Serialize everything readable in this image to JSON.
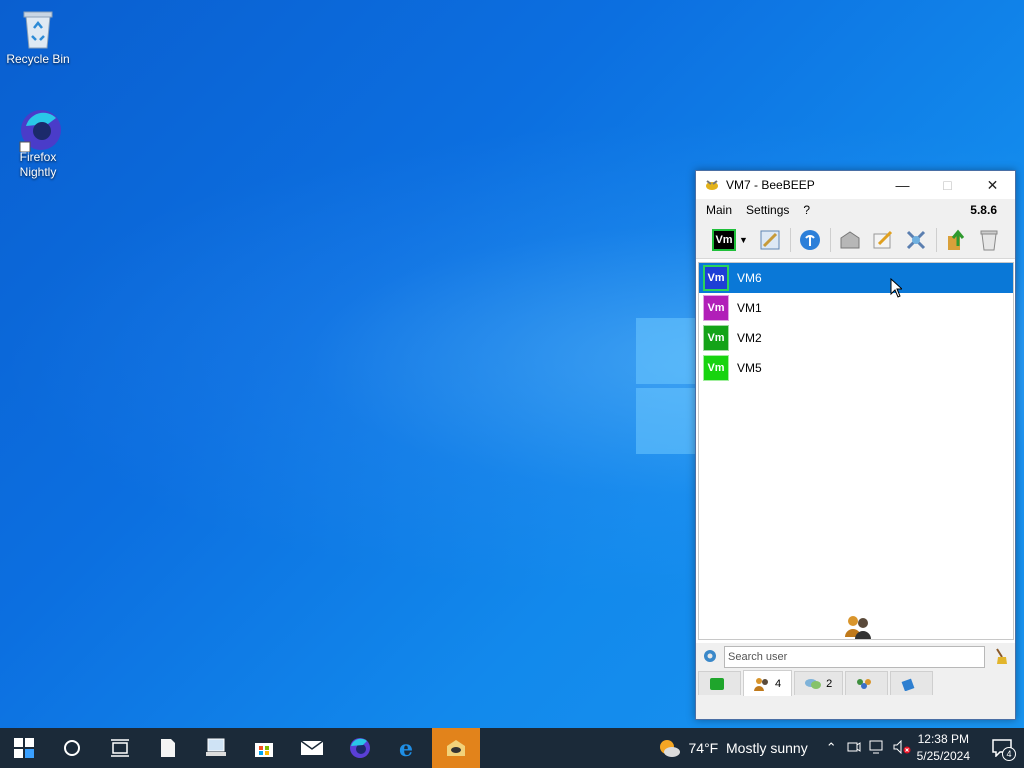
{
  "desktop": {
    "icons": [
      {
        "label": "Recycle Bin"
      },
      {
        "label": "Firefox Nightly"
      }
    ]
  },
  "window": {
    "title": "VM7 - BeeBEEP",
    "menu": [
      "Main",
      "Settings",
      "?"
    ],
    "version": "5.8.6",
    "self_badge": "Vm",
    "users": [
      {
        "badge": "Vm",
        "name": "VM6",
        "color": "#1d3fd6"
      },
      {
        "badge": "Vm",
        "name": "VM1",
        "color": "#b11fb8"
      },
      {
        "badge": "Vm",
        "name": "VM2",
        "color": "#14a318"
      },
      {
        "badge": "Vm",
        "name": "VM5",
        "color": "#17d40f"
      }
    ],
    "search_placeholder": "Search user",
    "tabs": [
      {
        "count": ""
      },
      {
        "count": "4"
      },
      {
        "count": "2"
      },
      {
        "count": ""
      },
      {
        "count": ""
      }
    ]
  },
  "taskbar": {
    "weather": "74°F  Mostly sunny",
    "time": "12:38 PM",
    "date": "5/25/2024",
    "notifications": "4"
  }
}
